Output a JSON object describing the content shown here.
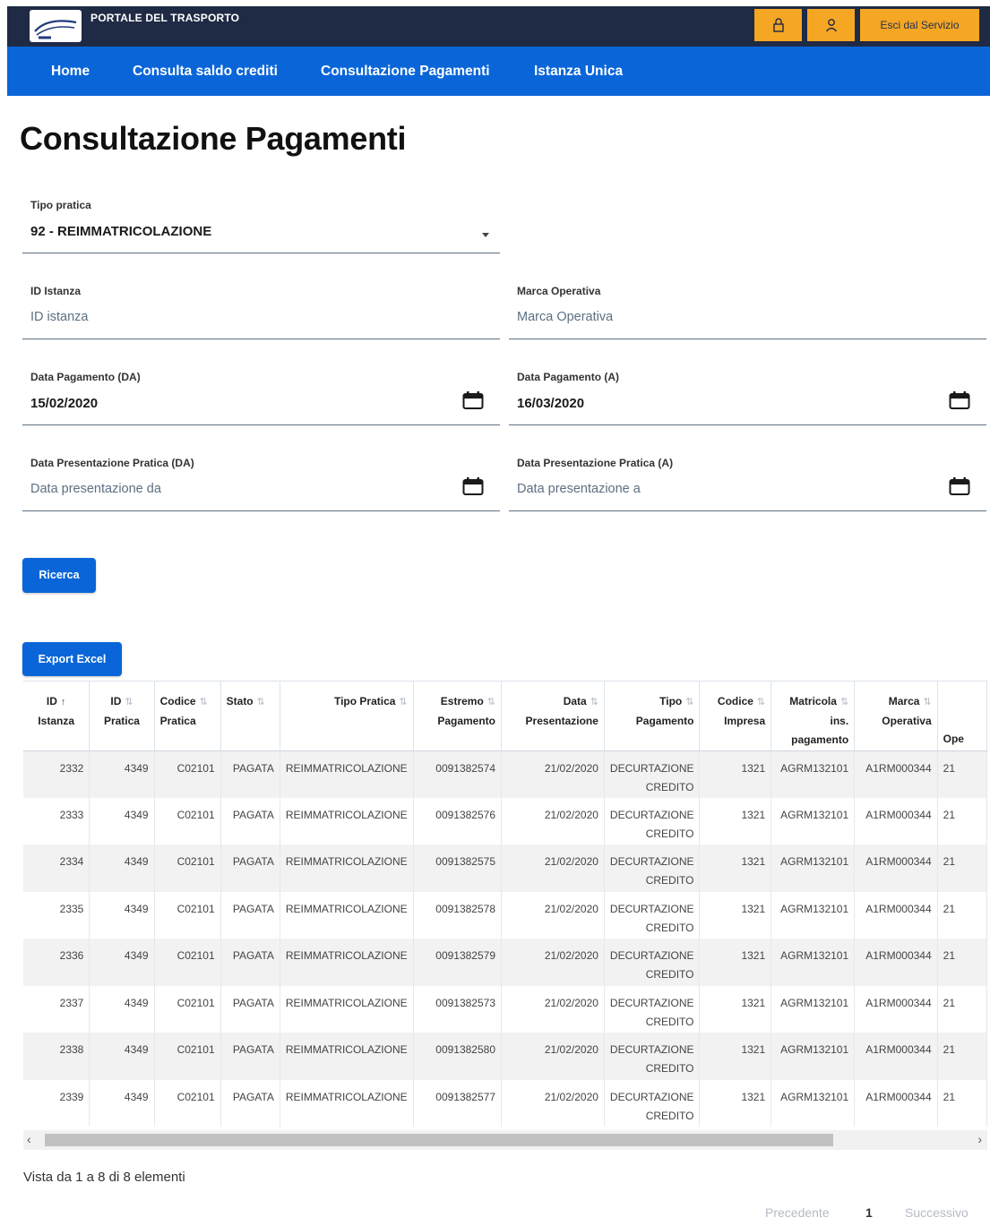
{
  "header": {
    "portal_title": "PORTALE DEL TRASPORTO",
    "logout_label": "Esci dal Servizio",
    "icons": [
      "lock-icon",
      "user-icon"
    ]
  },
  "nav": {
    "items": [
      "Home",
      "Consulta saldo crediti",
      "Consultazione Pagamenti",
      "Istanza Unica"
    ]
  },
  "page": {
    "title": "Consultazione Pagamenti"
  },
  "form": {
    "tipo_pratica": {
      "label": "Tipo pratica",
      "value": "92 - REIMMATRICOLAZIONE"
    },
    "id_istanza": {
      "label": "ID Istanza",
      "placeholder": "ID istanza"
    },
    "marca_operativa": {
      "label": "Marca Operativa",
      "placeholder": "Marca Operativa"
    },
    "data_pagamento_da": {
      "label": "Data Pagamento (DA)",
      "value": "15/02/2020"
    },
    "data_pagamento_a": {
      "label": "Data Pagamento (A)",
      "value": "16/03/2020"
    },
    "data_presentazione_da": {
      "label": "Data Presentazione Pratica (DA)",
      "placeholder": "Data presentazione da"
    },
    "data_presentazione_a": {
      "label": "Data Presentazione Pratica (A)",
      "placeholder": "Data presentazione a"
    },
    "search_button": "Ricerca"
  },
  "export_button": "Export Excel",
  "table": {
    "headers": [
      {
        "l1": "ID",
        "l2": "Istanza",
        "l3": ""
      },
      {
        "l1": "ID",
        "l2": "Pratica",
        "l3": ""
      },
      {
        "l1": "Codice",
        "l2": "Pratica",
        "l3": ""
      },
      {
        "l1": "Stato",
        "l2": "",
        "l3": ""
      },
      {
        "l1": "Tipo Pratica",
        "l2": "",
        "l3": ""
      },
      {
        "l1": "Estremo",
        "l2": "Pagamento",
        "l3": ""
      },
      {
        "l1": "Data",
        "l2": "Presentazione",
        "l3": ""
      },
      {
        "l1": "Tipo",
        "l2": "Pagamento",
        "l3": ""
      },
      {
        "l1": "Codice",
        "l2": "Impresa",
        "l3": ""
      },
      {
        "l1": "Matricola",
        "l2": "ins.",
        "l3": "pagamento"
      },
      {
        "l1": "Marca",
        "l2": "Operativa",
        "l3": ""
      },
      {
        "l1": "",
        "l2": "",
        "l3": "Ope"
      }
    ],
    "rows": [
      [
        "2332",
        "4349",
        "C02101",
        "PAGATA",
        "REIMMATRICOLAZIONE",
        "0091382574",
        "21/02/2020",
        "DECURTAZIONE",
        "CREDITO",
        "1321",
        "AGRM132101",
        "A1RM000344",
        "21"
      ],
      [
        "2333",
        "4349",
        "C02101",
        "PAGATA",
        "REIMMATRICOLAZIONE",
        "0091382576",
        "21/02/2020",
        "DECURTAZIONE",
        "CREDITO",
        "1321",
        "AGRM132101",
        "A1RM000344",
        "21"
      ],
      [
        "2334",
        "4349",
        "C02101",
        "PAGATA",
        "REIMMATRICOLAZIONE",
        "0091382575",
        "21/02/2020",
        "DECURTAZIONE",
        "CREDITO",
        "1321",
        "AGRM132101",
        "A1RM000344",
        "21"
      ],
      [
        "2335",
        "4349",
        "C02101",
        "PAGATA",
        "REIMMATRICOLAZIONE",
        "0091382578",
        "21/02/2020",
        "DECURTAZIONE",
        "CREDITO",
        "1321",
        "AGRM132101",
        "A1RM000344",
        "21"
      ],
      [
        "2336",
        "4349",
        "C02101",
        "PAGATA",
        "REIMMATRICOLAZIONE",
        "0091382579",
        "21/02/2020",
        "DECURTAZIONE",
        "CREDITO",
        "1321",
        "AGRM132101",
        "A1RM000344",
        "21"
      ],
      [
        "2337",
        "4349",
        "C02101",
        "PAGATA",
        "REIMMATRICOLAZIONE",
        "0091382573",
        "21/02/2020",
        "DECURTAZIONE",
        "CREDITO",
        "1321",
        "AGRM132101",
        "A1RM000344",
        "21"
      ],
      [
        "2338",
        "4349",
        "C02101",
        "PAGATA",
        "REIMMATRICOLAZIONE",
        "0091382580",
        "21/02/2020",
        "DECURTAZIONE",
        "CREDITO",
        "1321",
        "AGRM132101",
        "A1RM000344",
        "21"
      ],
      [
        "2339",
        "4349",
        "C02101",
        "PAGATA",
        "REIMMATRICOLAZIONE",
        "0091382577",
        "21/02/2020",
        "DECURTAZIONE",
        "CREDITO",
        "1321",
        "AGRM132101",
        "A1RM000344",
        "21"
      ]
    ]
  },
  "footer": {
    "info": "Vista da 1 a 8 di 8 elementi",
    "prev": "Precedente",
    "page": "1",
    "next": "Successivo"
  },
  "colors": {
    "topbar": "#1f2a44",
    "navbar": "#0a66d8",
    "accent": "#f5a623",
    "primary_button": "#0a66d8"
  }
}
